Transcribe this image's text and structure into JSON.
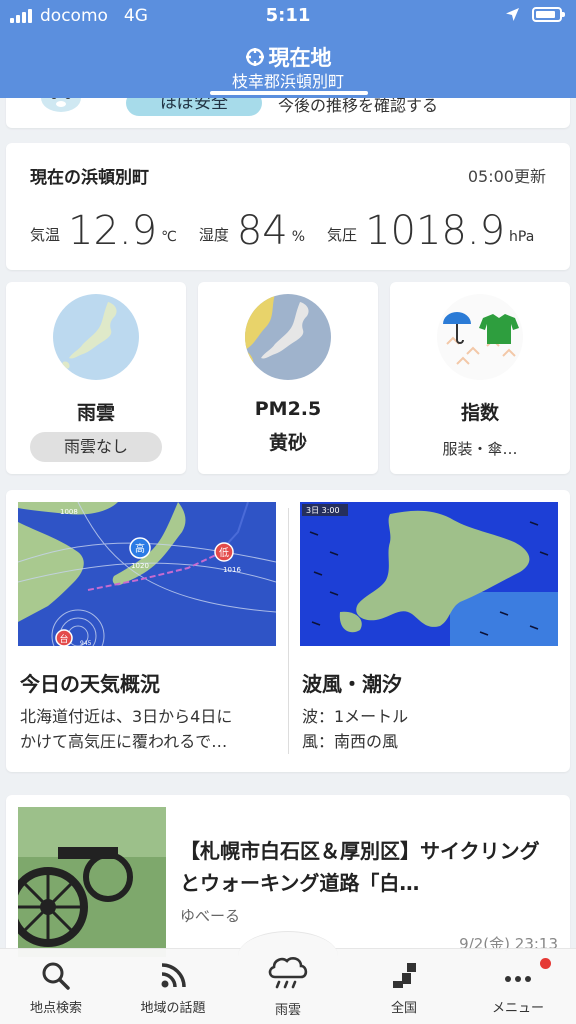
{
  "status_bar": {
    "carrier": "docomo",
    "network": "4G",
    "time": "5:11"
  },
  "header": {
    "title": "現在地",
    "subtitle": "枝幸郡浜頓別町"
  },
  "top_card": {
    "chip": "ほぼ安全",
    "info": "今後の推移を確認する"
  },
  "current": {
    "title": "現在の浜頓別町",
    "updated": "05:00更新",
    "temp_label": "気温",
    "temp_value": "12.9",
    "temp_unit": "℃",
    "humidity_label": "湿度",
    "humidity_value": "84",
    "humidity_unit": "%",
    "pressure_label": "気圧",
    "pressure_value": "1018.9",
    "pressure_unit": "hPa"
  },
  "tiles": {
    "rain": {
      "title": "雨雲",
      "pill": "雨雲なし"
    },
    "pm": {
      "title": "PM2.5",
      "subtitle": "黄砂"
    },
    "index": {
      "title": "指数",
      "desc": "服装・傘…"
    }
  },
  "overview": {
    "title": "今日の天気概況",
    "text1": "北海道付近は、3日から4日に",
    "text2": "かけて高気圧に覆われるで…",
    "map_labels": {
      "high": "高",
      "high_hpa": "1020",
      "low": "低",
      "low_hpa": "1016",
      "typhoon": "台",
      "typhoon_hpa": "945",
      "p1008": "1008"
    }
  },
  "wave": {
    "title": "波風・潮汐",
    "line1": "波：1メートル",
    "line2": "風：南西の風",
    "map_label": "3日 3:00"
  },
  "news": {
    "headline": "【札幌市白石区＆厚別区】サイクリングとウォーキング道路「白…",
    "source": "ゆべーる",
    "date": "9/2(金) 23:13"
  },
  "tabbar": {
    "search": "地点検索",
    "topics": "地域の話題",
    "rain": "雨雲",
    "national": "全国",
    "menu": "メニュー"
  },
  "colors": {
    "header": "#5b8fde",
    "accent_red": "#e53935",
    "sea": "#1f3fd1",
    "land": "#a9c98f"
  }
}
